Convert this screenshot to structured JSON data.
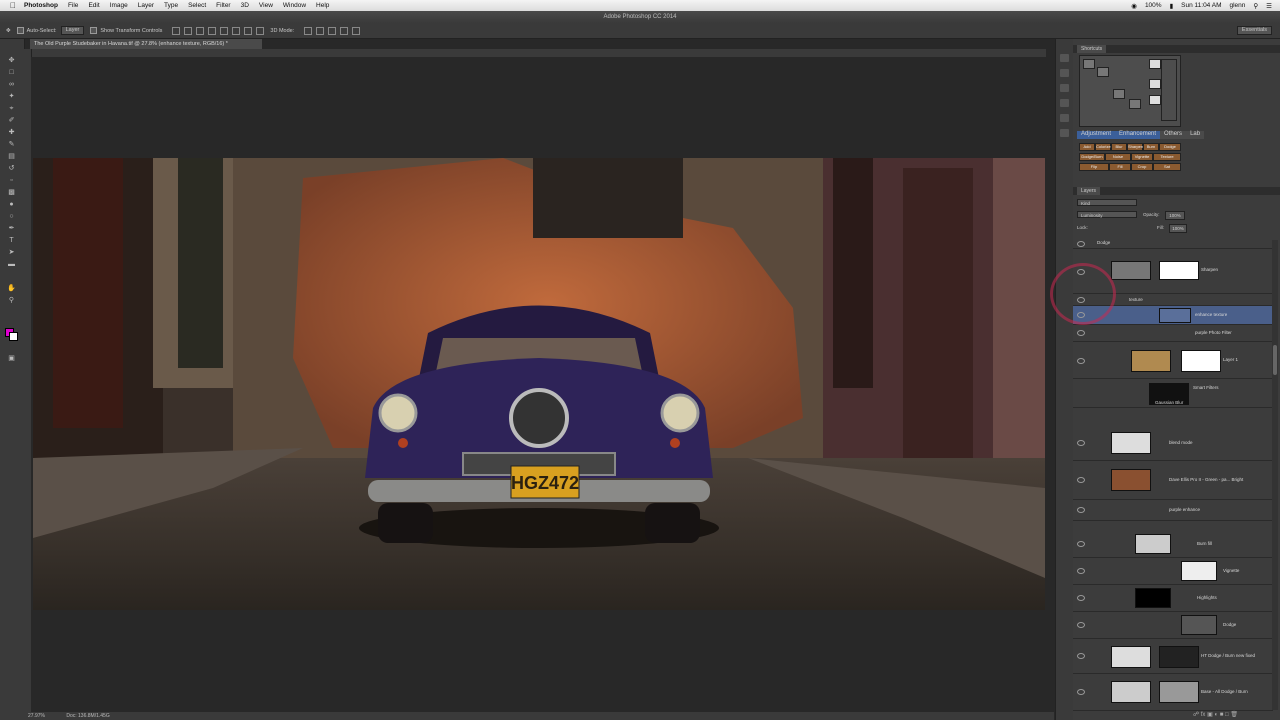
{
  "menubar": {
    "app": "Photoshop",
    "items": [
      "File",
      "Edit",
      "Image",
      "Layer",
      "Type",
      "Select",
      "Filter",
      "3D",
      "View",
      "Window",
      "Help"
    ],
    "right": {
      "battery": "100%",
      "time": "Sun 11:04 AM",
      "user": "glenn"
    }
  },
  "titlebar": {
    "title": "Adobe Photoshop CC 2014"
  },
  "options": {
    "auto_select": "Auto-Select:",
    "auto_select_value": "Layer",
    "show_transform": "Show Transform Controls",
    "mode_3d": "3D Mode:",
    "workspace": "Essentials"
  },
  "document": {
    "tab": "The Old Purple Studebaker in Havana.tif @ 27.8% (enhance texture, RGB/16) *"
  },
  "status": {
    "zoom": "27.97%",
    "doc": "Doc: 136.8M/1.45G"
  },
  "panels": {
    "shortcuts_title": "Shortcuts",
    "shortcuts_tabs": [
      "Adjustment",
      "Enhancement",
      "Others",
      "Lab"
    ],
    "shortcut_buttons": [
      "Add",
      "Colorize",
      "Blur",
      "Sharpen",
      "Burn",
      "Dodge",
      "Dodge/Burn",
      "Noise",
      "Vignette",
      "Texture",
      "Flip",
      "Fill",
      "Crop",
      "Sat",
      "Dehaze"
    ],
    "layers_title": "Layers",
    "kind": "Kind",
    "blend_mode": "Luminosity",
    "opacity_label": "Opacity:",
    "opacity_value": "100%",
    "lock_label": "Lock:",
    "fill_label": "Fill:",
    "fill_value": "100%"
  },
  "layers": [
    {
      "name": "Dodge",
      "kind": "group"
    },
    {
      "name": "Sharpen",
      "kind": "layer"
    },
    {
      "name": "texture",
      "kind": "group"
    },
    {
      "name": "enhance texture",
      "kind": "layer",
      "selected": true
    },
    {
      "name": "purple Photo Filter",
      "kind": "adjustment"
    },
    {
      "name": "Layer 1",
      "kind": "layer"
    },
    {
      "name": "Smart Filters",
      "kind": "filter"
    },
    {
      "name": "Gaussian Blur",
      "kind": "filter"
    },
    {
      "name": "blend mode",
      "kind": "layer"
    },
    {
      "name": "Dave Ellis Pro II - Green - pa... Bright",
      "kind": "layer"
    },
    {
      "name": "purple enhance",
      "kind": "adjustment"
    },
    {
      "name": "Burn fill",
      "kind": "group"
    },
    {
      "name": "Vignette",
      "kind": "layer"
    },
    {
      "name": "Highlights",
      "kind": "group"
    },
    {
      "name": "Dodge",
      "kind": "layer"
    },
    {
      "name": "HT Dodge / Burn new fixed",
      "kind": "layer"
    },
    {
      "name": "Base - All Dodge / Burn",
      "kind": "layer"
    }
  ],
  "colors": {
    "foreground": "#e000d0",
    "background": "#ffffff",
    "selection": "#4a5f8a"
  },
  "plate": "HGZ472"
}
